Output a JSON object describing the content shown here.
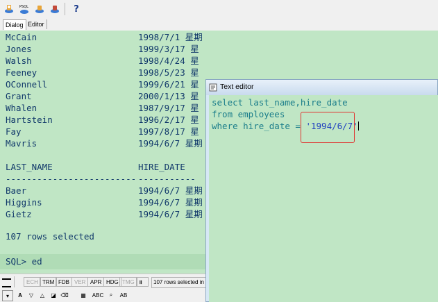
{
  "toolbar": {
    "icons": [
      "connect-icon",
      "sql-icon",
      "database-icon",
      "disconnect-icon",
      "help-icon"
    ],
    "help_label": "?"
  },
  "tabs": [
    {
      "label": "Dialog",
      "active": true
    },
    {
      "label": "Editor",
      "active": false
    }
  ],
  "console": {
    "rows_top": [
      {
        "name": "McCain",
        "date": "1998/7/1 星期"
      },
      {
        "name": "Jones",
        "date": "1999/3/17 星"
      },
      {
        "name": "Walsh",
        "date": "1998/4/24 星"
      },
      {
        "name": "Feeney",
        "date": "1998/5/23 星"
      },
      {
        "name": "OConnell",
        "date": "1999/6/21 星"
      },
      {
        "name": "Grant",
        "date": "2000/1/13 星"
      },
      {
        "name": "Whalen",
        "date": "1987/9/17 星"
      },
      {
        "name": "Hartstein",
        "date": "1996/2/17 星"
      },
      {
        "name": "Fay",
        "date": "1997/8/17 星"
      },
      {
        "name": "Mavris",
        "date": "1994/6/7 星期"
      }
    ],
    "header": {
      "col1": "LAST_NAME",
      "col2": "HIRE_DATE"
    },
    "separator": {
      "col1": "-------------------------",
      "col2": "-----------"
    },
    "rows_bottom": [
      {
        "name": "Baer",
        "date": "1994/6/7 星期"
      },
      {
        "name": "Higgins",
        "date": "1994/6/7 星期"
      },
      {
        "name": "Gietz",
        "date": "1994/6/7 星期"
      }
    ],
    "rows_selected": "107 rows selected",
    "prompt": "SQL> ed"
  },
  "editor": {
    "title": "Text editor",
    "line1": "select last_name,hire_date",
    "line2": "from employees",
    "line3_prefix": "where hire_date = ",
    "line3_string": "'1994/6/7'"
  },
  "statusbar": {
    "items": [
      {
        "label": "ECH",
        "dim": true
      },
      {
        "label": "TRM",
        "dim": false
      },
      {
        "label": "FDB",
        "dim": false
      },
      {
        "label": "VER",
        "dim": true
      },
      {
        "label": "APR",
        "dim": false
      },
      {
        "label": "HDG",
        "dim": false
      },
      {
        "label": "TMG",
        "dim": true
      }
    ],
    "message": "107 rows selected in"
  },
  "bottombar": {
    "abc_label": "ABC",
    "ab_label": "AB"
  }
}
